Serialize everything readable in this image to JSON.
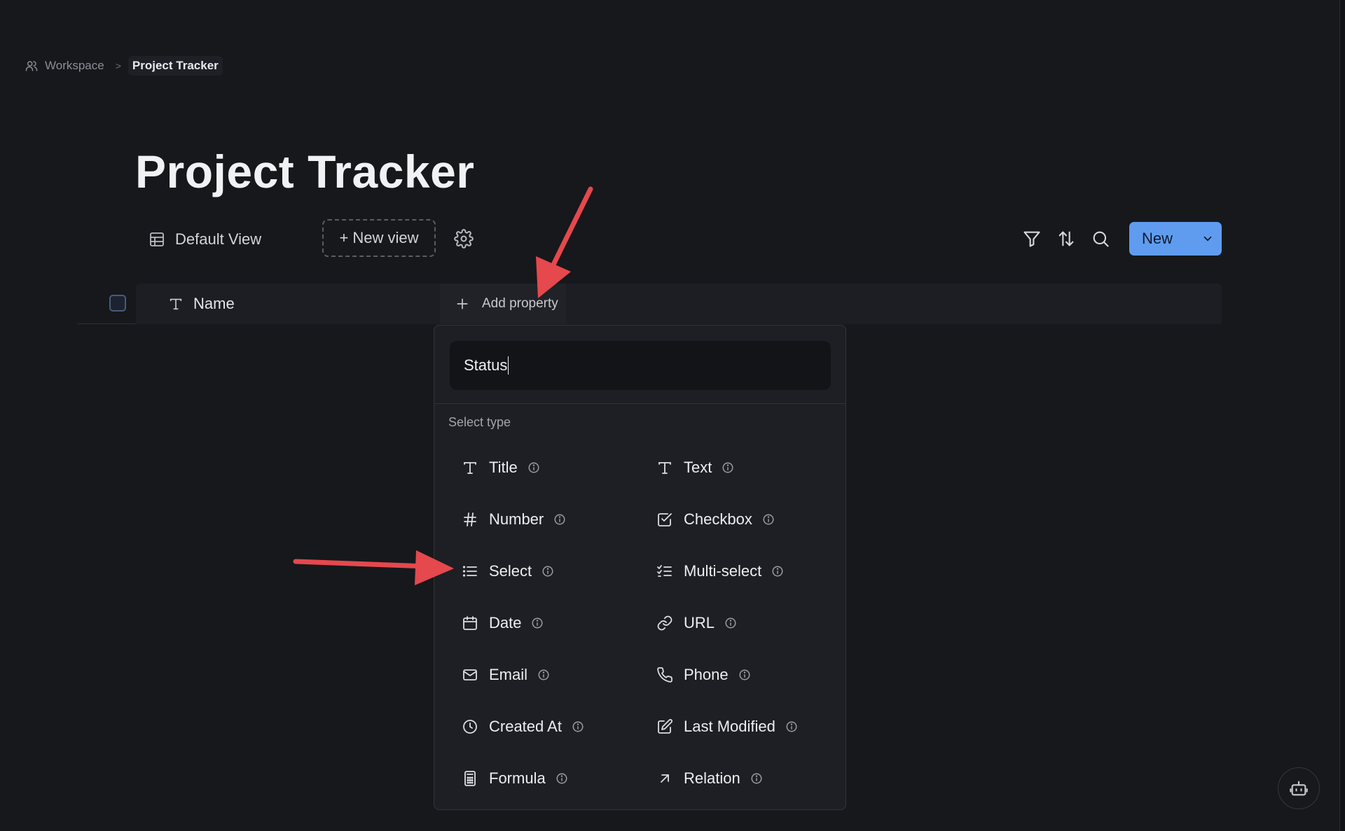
{
  "breadcrumb": {
    "workspace": "Workspace",
    "separator": ">",
    "current": "Project Tracker"
  },
  "page_title": "Project Tracker",
  "views": {
    "default_view": "Default View",
    "new_view": "+ New view"
  },
  "toolbar": {
    "icons": [
      "filter-icon",
      "sort-icon",
      "search-icon"
    ],
    "new_label": "New"
  },
  "table": {
    "columns": [
      {
        "label": "Name",
        "icon": "text-type-icon"
      }
    ],
    "add_property": "Add property"
  },
  "property_menu": {
    "input_value": "Status",
    "section_label": "Select type",
    "types": [
      {
        "label": "Title",
        "icon": "title-icon"
      },
      {
        "label": "Text",
        "icon": "text-icon"
      },
      {
        "label": "Number",
        "icon": "hash-icon"
      },
      {
        "label": "Checkbox",
        "icon": "checkbox-icon"
      },
      {
        "label": "Select",
        "icon": "list-icon"
      },
      {
        "label": "Multi-select",
        "icon": "checklist-icon"
      },
      {
        "label": "Date",
        "icon": "calendar-icon"
      },
      {
        "label": "URL",
        "icon": "link-icon"
      },
      {
        "label": "Email",
        "icon": "mail-icon"
      },
      {
        "label": "Phone",
        "icon": "phone-icon"
      },
      {
        "label": "Created At",
        "icon": "clock-icon"
      },
      {
        "label": "Last Modified",
        "icon": "edit-icon"
      },
      {
        "label": "Formula",
        "icon": "calculator-icon"
      },
      {
        "label": "Relation",
        "icon": "arrow-up-right-icon"
      }
    ]
  },
  "colors": {
    "background": "#16181c",
    "accent": "#5f9cf0",
    "annotation_arrow": "#e5484d"
  }
}
